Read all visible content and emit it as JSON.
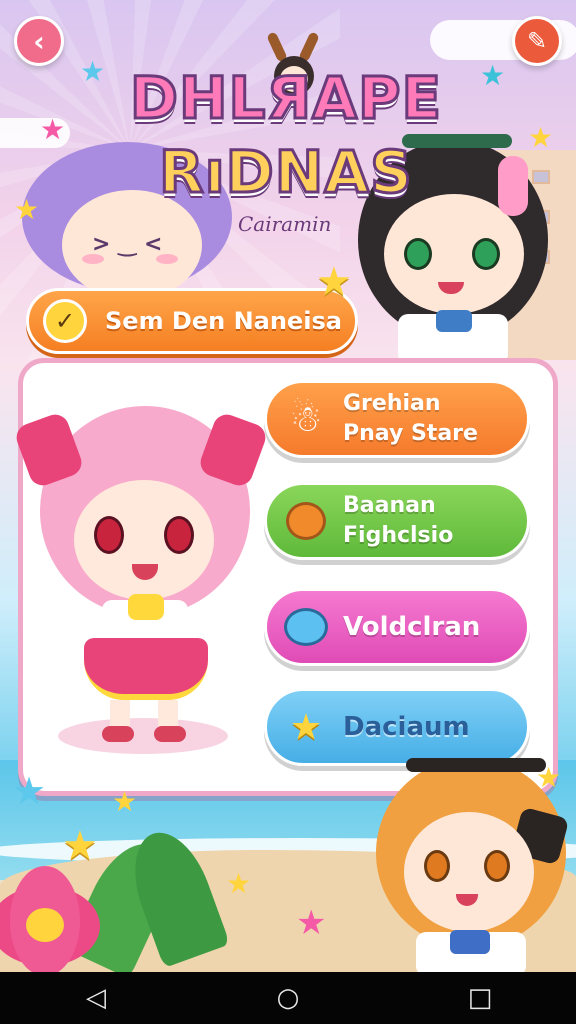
{
  "header": {
    "back_icon": "‹",
    "edit_icon": "✎",
    "logo_line1": "DHLЯAPE",
    "logo_line2": "RıDNAS",
    "logo_subtitle": "Cairamin"
  },
  "mode_banner": {
    "check_icon": "✓",
    "label": "Sem Den Naneisa"
  },
  "menu": {
    "items": [
      {
        "icon": "ghost-icon",
        "glyph": "☃",
        "label_line1": "Grehian",
        "label_line2": "Pnay Stare",
        "color": "#f57a2c"
      },
      {
        "icon": "bear-icon",
        "glyph": "🐻",
        "label_line1": "Baanan",
        "label_line2": "Fighclsio",
        "color": "#5fb93a"
      },
      {
        "icon": "blue-creature-icon",
        "glyph": "●",
        "label_line1": "Voldclran",
        "label_line2": "",
        "color": "#e04bb6"
      },
      {
        "icon": "star-icon",
        "glyph": "★",
        "label_line1": "Daciaum",
        "label_line2": "",
        "color": "#46aee6"
      }
    ]
  },
  "navbar": {
    "back": "◁",
    "home": "○",
    "recents": "□"
  }
}
